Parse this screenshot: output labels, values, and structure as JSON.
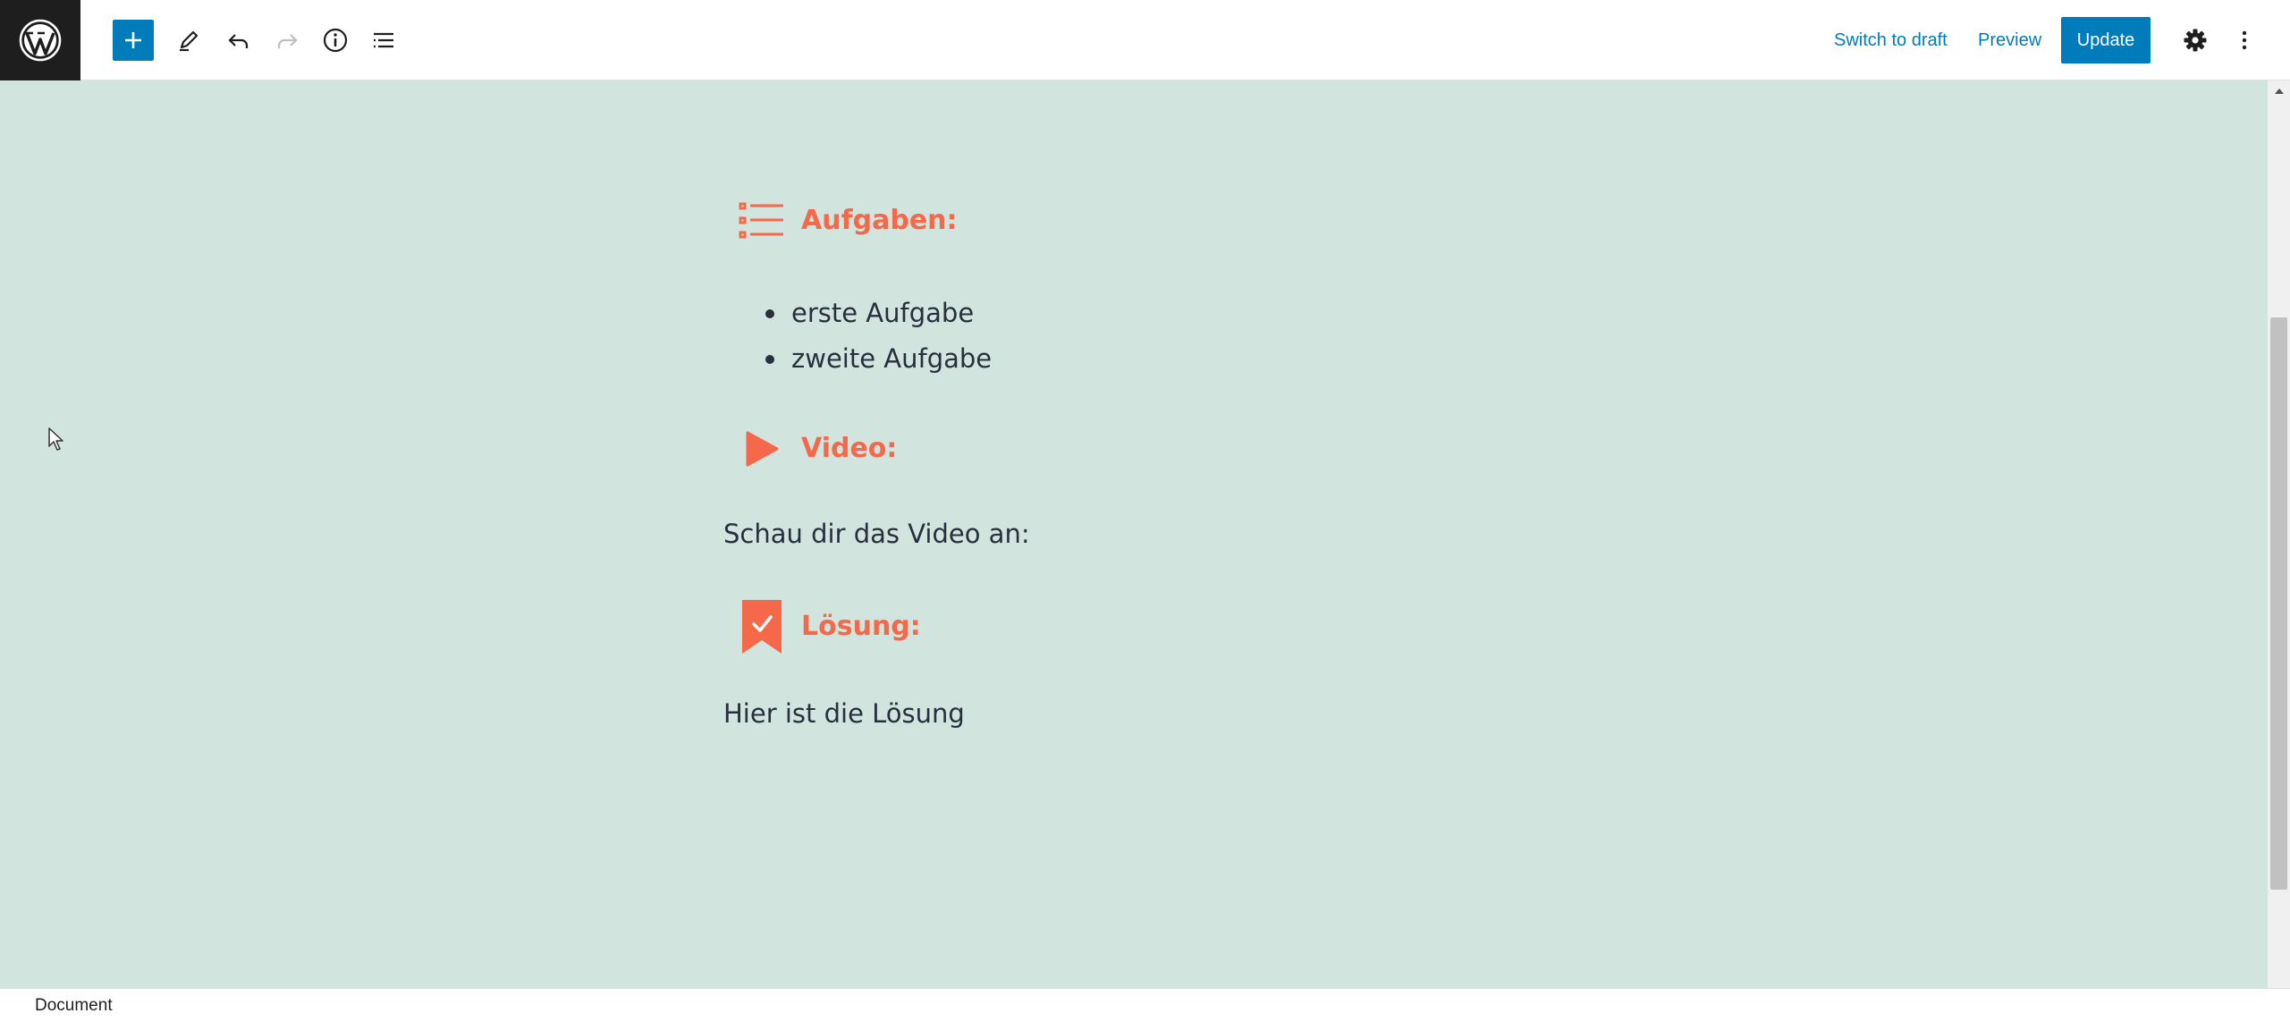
{
  "toolbar": {
    "logo": "wordpress-logo",
    "icons": [
      "add-block-icon",
      "pencil-tools-icon",
      "undo-icon",
      "redo-icon",
      "info-icon",
      "list-view-icon",
      "gear-icon",
      "more-options-icon"
    ],
    "switch_to_draft_label": "Switch to draft",
    "preview_label": "Preview",
    "update_label": "Update"
  },
  "content": {
    "headings": [
      {
        "icon": "task-list-icon",
        "text": "Aufgaben:"
      },
      {
        "icon": "play-icon",
        "text": "Video:"
      },
      {
        "icon": "bookmark-check-icon",
        "text": "Lösung:"
      }
    ],
    "tasks": [
      "erste Aufgabe",
      "zweite Aufgabe"
    ],
    "video_text": "Schau dir das Video an:",
    "solution_text": "Hier ist die Lösung"
  },
  "footer": {
    "breadcrumb": "Document"
  },
  "colors": {
    "accent": "#007cba",
    "canvas_bg": "#d1e4dd",
    "heading": "#f5694a",
    "text": "#28303d",
    "logo_bg": "#1e1e1e"
  }
}
